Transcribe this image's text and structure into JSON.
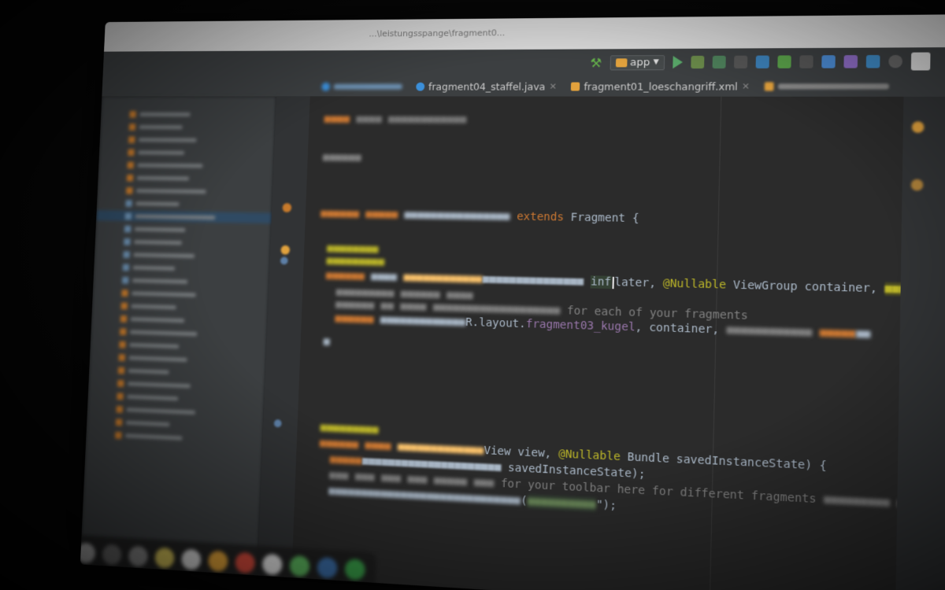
{
  "window": {
    "path_text": "...\\leistungsspange\\fragment0..."
  },
  "toolbar": {
    "run_config": "app",
    "accent_colors": {
      "run": "#59a869",
      "folder": "#e0a13d",
      "hammer": "#65b24a"
    }
  },
  "tabs": [
    {
      "label": "fragment04_staffel.java",
      "icon": "java-class-icon"
    },
    {
      "label": "fragment01_loeschangriff.xml",
      "icon": "xml-layout-icon"
    }
  ],
  "code": {
    "l1_kw": "extends",
    "l1_rest": "Fragment {",
    "l2_a": "inf",
    "l2_b": "later,",
    "l2_ann": "@Nullable",
    "l2_rest": "ViewGroup container,",
    "l3": "for each of your fragments",
    "l4_a": "R.layout.",
    "l4_b": "fragment03_kugel",
    "l4_c": ", container,",
    "l5_a": "View view,",
    "l5_ann": "@Nullable",
    "l5_b": "Bundle savedInstanceState) {",
    "l6": "savedInstanceState);",
    "l7": "for your toolbar here for different fragments",
    "l8_a": "(",
    "l8_b": "\");"
  },
  "colors": {
    "editor_bg": "#2b2b2b",
    "keyword": "#cc7832",
    "annotation": "#bbb529",
    "field": "#9876aa",
    "comment": "#808080",
    "string": "#6a8759",
    "text": "#a9b7c6"
  }
}
